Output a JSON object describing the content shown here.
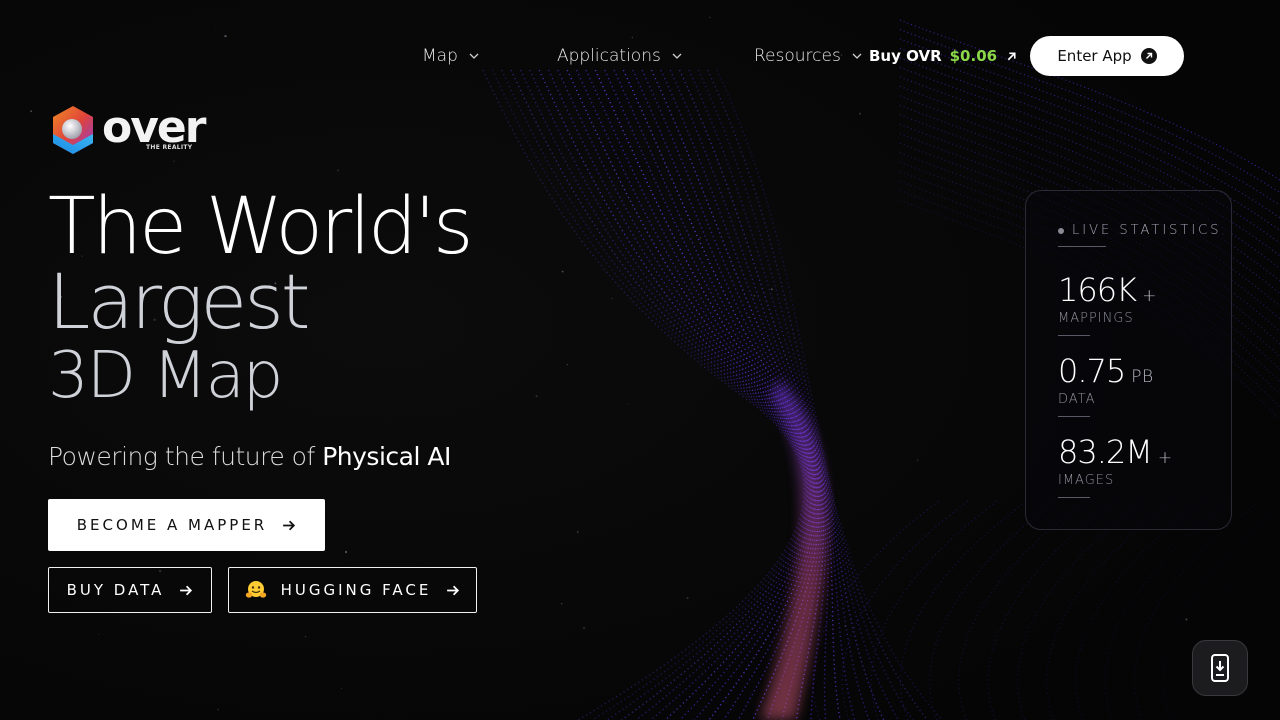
{
  "nav": {
    "items": [
      {
        "label": "Map"
      },
      {
        "label": "Applications"
      },
      {
        "label": "Resources"
      }
    ],
    "buy_label": "Buy OVR",
    "buy_price": "$0.06",
    "enter_app": "Enter App"
  },
  "logo": {
    "wordmark": "over",
    "tagline": "THE REALITY"
  },
  "hero": {
    "line1": "The World's",
    "line2": "Largest",
    "line3": "3D Map",
    "subtitle_prefix": "Powering the future of ",
    "subtitle_emphasis": "Physical AI"
  },
  "buttons": {
    "become_mapper": "BECOME A MAPPER",
    "buy_data": "BUY DATA",
    "hugging_face": "HUGGING FACE"
  },
  "stats": {
    "heading": "LIVE STATISTICS",
    "items": [
      {
        "value": "166K",
        "unit": "+",
        "label": "MAPPINGS"
      },
      {
        "value": "0.75",
        "unit": "PB",
        "label": "DATA"
      },
      {
        "value": "83.2M",
        "unit": "+",
        "label": "IMAGES"
      }
    ]
  },
  "icons": {
    "nav_chevron": "chevron-down-icon",
    "buy_arrow": "arrow-up-right-icon",
    "enter_arrow": "arrow-circle-icon",
    "button_arrow": "arrow-right-icon",
    "hugging_face": "hugging-face-emoji-icon",
    "fab": "phone-download-icon"
  },
  "colors": {
    "background": "#080808",
    "price": "#8bd84a",
    "wave_primary": "#5a2dd6",
    "wave_accent": "#e05a8a"
  }
}
